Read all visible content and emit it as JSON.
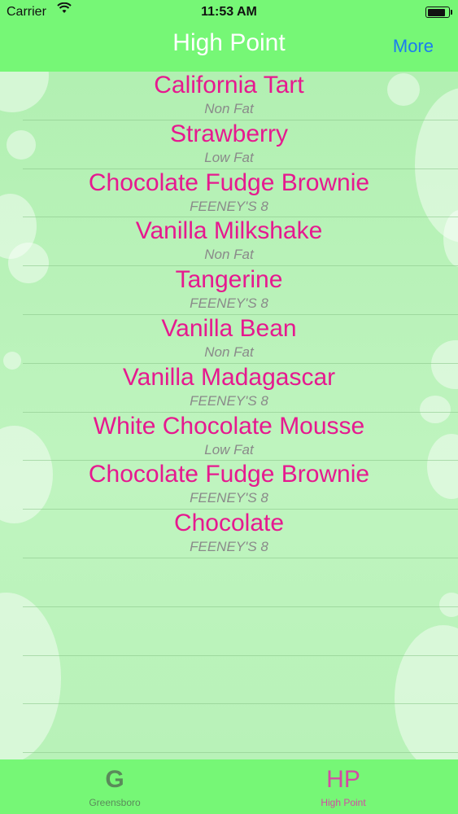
{
  "status_bar": {
    "carrier": "Carrier",
    "time": "11:53 AM",
    "battery_level": 0.9
  },
  "nav": {
    "title": "High Point",
    "more_label": "More"
  },
  "flavors": [
    {
      "name": "California Tart",
      "detail": "Non Fat"
    },
    {
      "name": "Strawberry",
      "detail": "Low Fat"
    },
    {
      "name": "Chocolate Fudge Brownie",
      "detail": "FEENEY'S 8"
    },
    {
      "name": "Vanilla Milkshake",
      "detail": "Non Fat"
    },
    {
      "name": "Tangerine",
      "detail": "FEENEY'S 8"
    },
    {
      "name": "Vanilla Bean",
      "detail": "Non Fat"
    },
    {
      "name": "Vanilla Madagascar",
      "detail": "FEENEY'S 8"
    },
    {
      "name": "White Chocolate Mousse",
      "detail": "Low Fat"
    },
    {
      "name": "Chocolate Fudge Brownie",
      "detail": "FEENEY'S 8"
    },
    {
      "name": "Chocolate",
      "detail": "FEENEY'S 8"
    }
  ],
  "tabs": [
    {
      "glyph": "G",
      "label": "Greensboro",
      "selected": false
    },
    {
      "glyph": "HP",
      "label": "High Point",
      "selected": true
    }
  ],
  "colors": {
    "bar_green": "#76f776",
    "flavor_pink": "#e6198f",
    "more_blue": "#1a7cf0",
    "selected_tab": "#d44aa4"
  }
}
